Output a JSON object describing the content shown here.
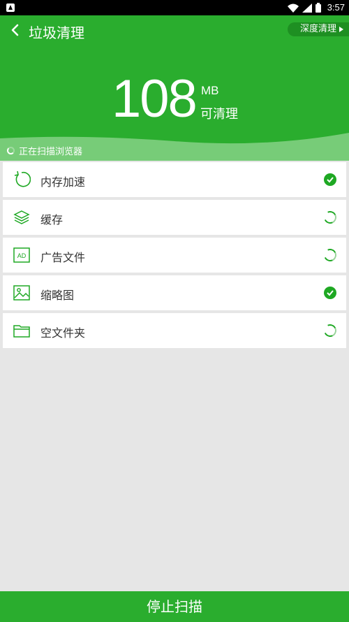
{
  "status_bar": {
    "time": "3:57"
  },
  "header": {
    "title": "垃圾清理",
    "deep_clean_label": "深度清理",
    "size_value": "108",
    "size_unit": "MB",
    "size_label": "可清理",
    "scan_status": "正在扫描浏览器"
  },
  "items": [
    {
      "label": "内存加速",
      "icon": "refresh-icon",
      "state": "done"
    },
    {
      "label": "缓存",
      "icon": "layers-icon",
      "state": "scanning"
    },
    {
      "label": "广告文件",
      "icon": "ad-icon",
      "state": "scanning"
    },
    {
      "label": "缩略图",
      "icon": "image-icon",
      "state": "done"
    },
    {
      "label": "空文件夹",
      "icon": "folder-icon",
      "state": "scanning"
    }
  ],
  "footer": {
    "stop_label": "停止扫描"
  },
  "colors": {
    "primary": "#2aad2e",
    "accent_dark": "#1e8f22",
    "check": "#1ea823"
  }
}
